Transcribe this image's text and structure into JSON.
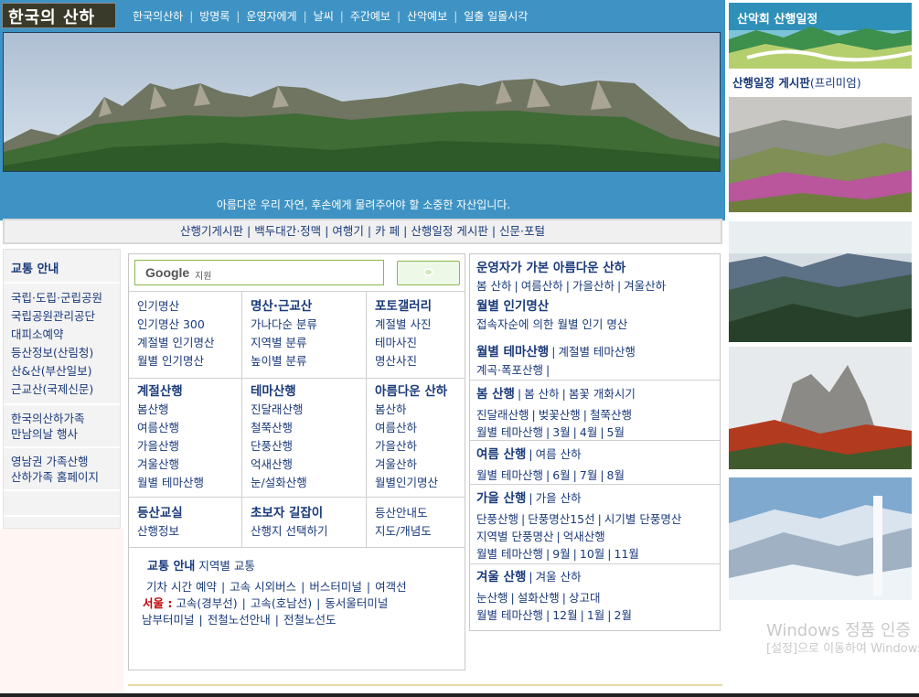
{
  "header": {
    "logo_text": "한국의 산하",
    "top_nav": [
      "한국의산하",
      "방명록",
      "운영자에게",
      "날씨",
      "주간예보",
      "산악예보",
      "일출 일몰시각"
    ],
    "tagline": "아름다운 우리 자연, 후손에게 물려주어야 할 소중한 자산입니다."
  },
  "nav2": [
    "산행기게시판",
    "백두대간·정맥",
    "여행기",
    "카 페",
    "산행일정 게시판",
    "신문·포털"
  ],
  "left_sidebar": {
    "title": "교통 안내",
    "group1": [
      "국립·도립·군립공원",
      "국립공원관리공단",
      "대피소예약",
      "등산정보(산림청)",
      "산&산(부산일보)",
      "근교산(국제신문)"
    ],
    "group2": [
      "한국의산하가족",
      "만남의날 행사"
    ],
    "group3": [
      "영남권 가족산행",
      "산하가족 홈페이지"
    ]
  },
  "search": {
    "logo": "Google",
    "placeholder": "지원"
  },
  "grid": {
    "c1": {
      "items": [
        "인기명산",
        "인기명산 300",
        "계절별 인기명산",
        "월별 인기명산"
      ]
    },
    "c2": {
      "title": "명산·근교산",
      "items": [
        "가나다순 분류",
        "지역별 분류",
        "높이별 분류"
      ]
    },
    "c3": {
      "title": "포토갤러리",
      "items": [
        "계절별 사진",
        "테마사진",
        "명산사진"
      ]
    },
    "c4": {
      "title": "계절산행",
      "items": [
        "봄산행",
        "여름산행",
        "가을산행",
        "겨울산행",
        "월별 테마산행"
      ]
    },
    "c5": {
      "title": "테마산행",
      "items": [
        "진달래산행",
        "철쭉산행",
        "단풍산행",
        "억새산행",
        "눈/설화산행"
      ]
    },
    "c6": {
      "title": "아름다운 산하",
      "items": [
        "봄산하",
        "여름산하",
        "가을산하",
        "겨울산하",
        "월별인기명산"
      ]
    },
    "c7": {
      "title": "등산교실",
      "items": [
        "산행정보"
      ]
    },
    "c8": {
      "title": "초보자 길잡이",
      "items": [
        "산행지 선택하기"
      ]
    },
    "c9": {
      "items": [
        "등산안내도",
        "지도/개념도"
      ]
    }
  },
  "traffic": {
    "title": "교통 안내",
    "subtitle": "지역별 교통",
    "row1": [
      "기차 시간 예약",
      "고속 시외버스",
      "버스터미널",
      "여객선"
    ],
    "seoul_label": "서울 :",
    "row2": [
      "고속(경부선)",
      "고속(호남선)",
      "동서울터미널"
    ],
    "row3": [
      "남부터미널",
      "전철노선안내",
      "전철노선도"
    ]
  },
  "right": {
    "s1": {
      "title": "운영자가 가본 아름다운 산하",
      "links": [
        "봄 산하",
        "여름산하",
        "가을산하",
        "겨울산하"
      ]
    },
    "s2": {
      "title": "월별 인기명산",
      "text": "접속자순에 의한 월별 인기 명산"
    },
    "s3": {
      "title": "월별 테마산행",
      "extra": "계절별 테마산행",
      "line2": "계곡·폭포산행"
    },
    "s4": {
      "title": "봄 산행",
      "head": [
        "봄 산하",
        "봄꽃 개화시기"
      ],
      "line1": [
        "진달래산행",
        "벚꽃산행",
        "철쭉산행"
      ],
      "line2": [
        "월별 테마산행",
        "3월",
        "4월",
        "5월"
      ]
    },
    "s5": {
      "title": "여름 산행",
      "head": [
        "여름 산하"
      ],
      "line1": [
        "월별 테마산행",
        "6월",
        "7월",
        "8월"
      ]
    },
    "s6": {
      "title": "가을 산행",
      "head": [
        "가을 산하"
      ],
      "line1": [
        "단풍산행",
        "단풍명산15선",
        "시기별 단풍명산"
      ],
      "line2": [
        "지역별 단풍명산",
        "억새산행"
      ],
      "line3": [
        "월별 테마산행",
        "9월",
        "10월",
        "11월"
      ]
    },
    "s7": {
      "title": "겨울 산행",
      "head": [
        "겨울 산하"
      ],
      "line1": [
        "눈산행",
        "설화산행",
        "상고대"
      ],
      "line2": [
        "월별 테마산행",
        "12월",
        "1월",
        "2월"
      ]
    }
  },
  "far_right": {
    "title": "산악회 산행일정",
    "link_bold": "산행일정 게시판",
    "link_normal": "(프리미엄)"
  },
  "watermark": {
    "line1": "Windows 정품 인증",
    "line2": "[설정]으로 이동하여 Windows"
  },
  "colors": {
    "header_blue": "#3e93c4",
    "link": "#1a3a7a",
    "seoul_red": "#c00000"
  }
}
